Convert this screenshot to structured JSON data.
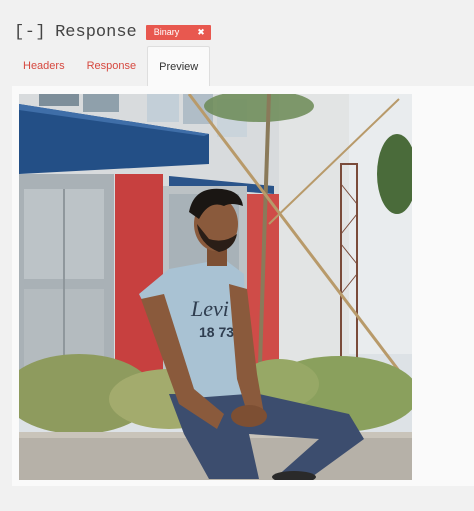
{
  "header": {
    "toggle": "[-]",
    "title": "Response",
    "badge": {
      "label": "Binary",
      "close": "✖"
    }
  },
  "tabs": [
    {
      "label": "Headers",
      "active": false
    },
    {
      "label": "Response",
      "active": false
    },
    {
      "label": "Preview",
      "active": true
    }
  ],
  "preview": {
    "image_kind": "photo of a young man sitting on a low concrete wall in front of plants and a building",
    "shirt_print": {
      "brand": "Levi's",
      "number": "1873"
    }
  },
  "colors": {
    "accent": "#e8584f",
    "tab_link": "#d6483f"
  }
}
